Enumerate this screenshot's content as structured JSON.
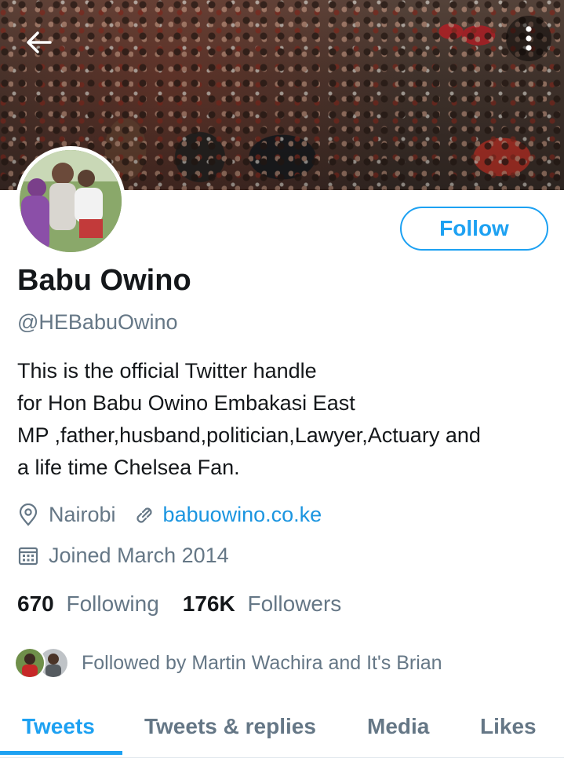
{
  "profile": {
    "name": "Babu Owino",
    "handle": "@HEBabuOwino",
    "bio_lines": [
      "This is the official Twitter handle",
      "for Hon Babu Owino Embakasi East",
      "MP ,father,husband,politician,Lawyer,Actuary and",
      "a life time Chelsea Fan."
    ],
    "location": "Nairobi",
    "website": "babuowino.co.ke",
    "joined": "Joined March 2014",
    "following_count": "670",
    "following_label": "Following",
    "followers_count": "176K",
    "followers_label": "Followers",
    "followed_by": "Followed by Martin Wachira and It's Brian"
  },
  "actions": {
    "follow_label": "Follow"
  },
  "tabs": [
    {
      "label": "Tweets",
      "active": true
    },
    {
      "label": "Tweets & replies",
      "active": false
    },
    {
      "label": "Media",
      "active": false
    },
    {
      "label": "Likes",
      "active": false
    }
  ],
  "icons": {
    "back": "arrow-left-icon",
    "menu": "more-vertical-icon",
    "location": "location-pin-icon",
    "website": "link-icon",
    "joined": "calendar-icon"
  },
  "colors": {
    "accent": "#1da1f2",
    "link": "#1b95e0",
    "secondary_text": "#657786",
    "primary_text": "#14171a"
  }
}
